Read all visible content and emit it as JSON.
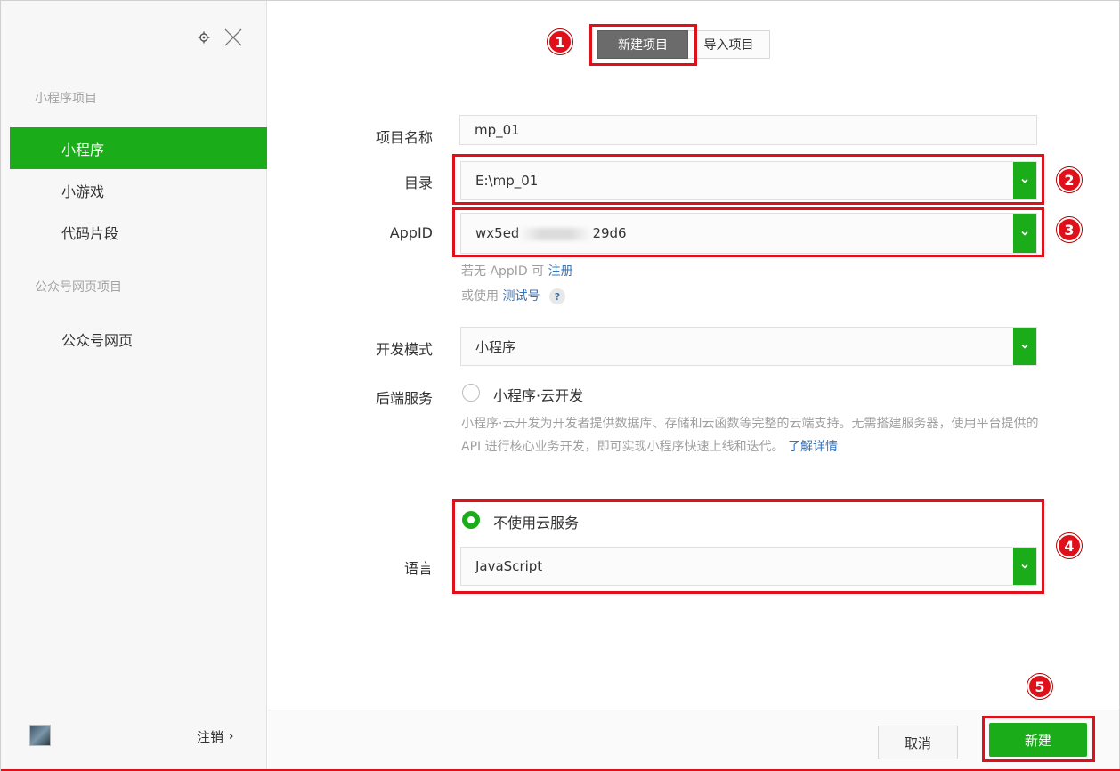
{
  "sidebar": {
    "sections": [
      {
        "title": "小程序项目",
        "items": [
          {
            "label": "小程序",
            "active": true
          },
          {
            "label": "小游戏",
            "active": false
          },
          {
            "label": "代码片段",
            "active": false
          }
        ]
      },
      {
        "title": "公众号网页项目",
        "items": [
          {
            "label": "公众号网页",
            "active": false
          }
        ]
      }
    ],
    "logout_label": "注销",
    "logout_arrow": "›"
  },
  "tabs": [
    {
      "label": "新建项目",
      "active": true
    },
    {
      "label": "导入项目",
      "active": false
    }
  ],
  "form": {
    "project_name": {
      "label": "项目名称",
      "value": "mp_01"
    },
    "directory": {
      "label": "目录",
      "value": "E:\\mp_01"
    },
    "appid": {
      "label": "AppID",
      "value_prefix": "wx5ed",
      "value_suffix": "29d6"
    },
    "appid_hint_1_prefix": "若无 AppID 可",
    "appid_hint_1_link": "注册",
    "appid_hint_2_prefix": "或使用",
    "appid_hint_2_link": "测试号",
    "appid_hint_2_q": "?",
    "dev_mode": {
      "label": "开发模式",
      "value": "小程序"
    },
    "backend": {
      "label": "后端服务",
      "option_cloud": "小程序·云开发",
      "description": "小程序·云开发为开发者提供数据库、存储和云函数等完整的云端支持。无需搭建服务器，使用平台提供的 API 进行核心业务开发，即可实现小程序快速上线和迭代。",
      "learn_more": "了解详情",
      "option_none": "不使用云服务",
      "selected": "不使用云服务"
    },
    "language": {
      "label": "语言",
      "value": "JavaScript"
    }
  },
  "footer": {
    "cancel_label": "取消",
    "create_label": "新建"
  },
  "annotations": [
    "1",
    "2",
    "3",
    "4",
    "5"
  ],
  "colors": {
    "accent_green": "#1aad19",
    "annotation_red": "#e0101a",
    "link_blue": "#3b73b9"
  }
}
